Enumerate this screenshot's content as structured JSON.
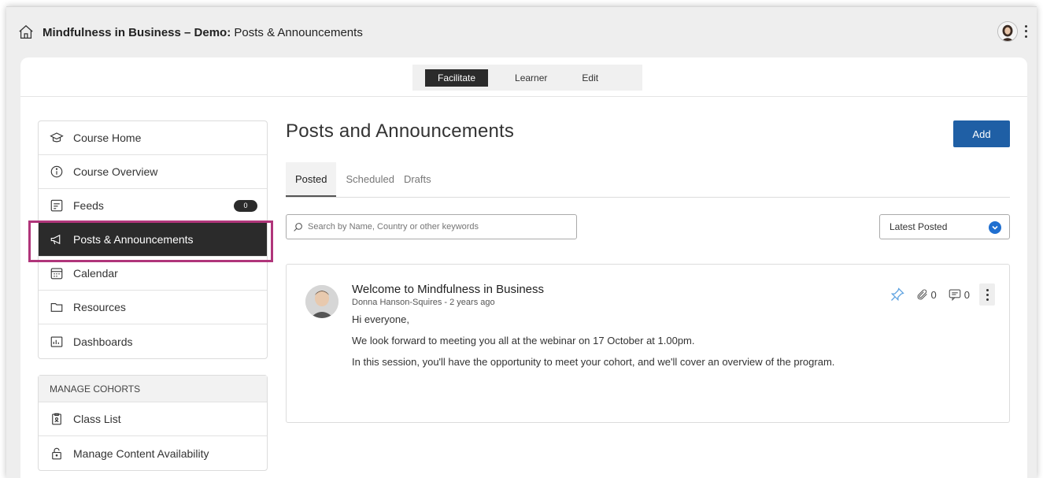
{
  "header": {
    "title_bold": "Mindfulness in Business – Demo:",
    "title_rest": " Posts & Announcements"
  },
  "mode_tabs": [
    "Facilitate",
    "Learner",
    "Edit"
  ],
  "sidebar": {
    "items": [
      {
        "label": "Course Home",
        "icon": "graduation-cap-icon"
      },
      {
        "label": "Course Overview",
        "icon": "info-icon"
      },
      {
        "label": "Feeds",
        "icon": "feed-icon",
        "badge": "0"
      },
      {
        "label": "Posts & Announcements",
        "icon": "megaphone-icon",
        "active": true
      },
      {
        "label": "Calendar",
        "icon": "calendar-icon"
      },
      {
        "label": "Resources",
        "icon": "folder-icon"
      },
      {
        "label": "Dashboards",
        "icon": "dashboard-icon"
      }
    ],
    "cohorts": {
      "heading": "MANAGE COHORTS",
      "items": [
        {
          "label": "Class List",
          "icon": "clipboard-icon"
        },
        {
          "label": "Manage Content Availability",
          "icon": "lock-icon"
        }
      ]
    }
  },
  "main": {
    "title": "Posts and Announcements",
    "add_label": "Add",
    "tabs": [
      "Posted",
      "Scheduled",
      "Drafts"
    ],
    "search_placeholder": "Search by Name, Country or other keywords",
    "sort_label": "Latest Posted"
  },
  "post": {
    "title": "Welcome to Mindfulness in Business",
    "meta": "Donna Hanson-Squires - 2 years ago",
    "body": [
      "Hi everyone,",
      "We look forward to meeting you all at the webinar on 17 October at 1.00pm.",
      "In this session, you'll have the opportunity to meet your cohort, and we'll cover an overview of the program."
    ],
    "attachments_count": "0",
    "comments_count": "0"
  },
  "colors": {
    "accent": "#1f5fa5",
    "highlight": "#b0357a",
    "active_dark": "#2b2b2b",
    "pin": "#5aa0e0"
  }
}
